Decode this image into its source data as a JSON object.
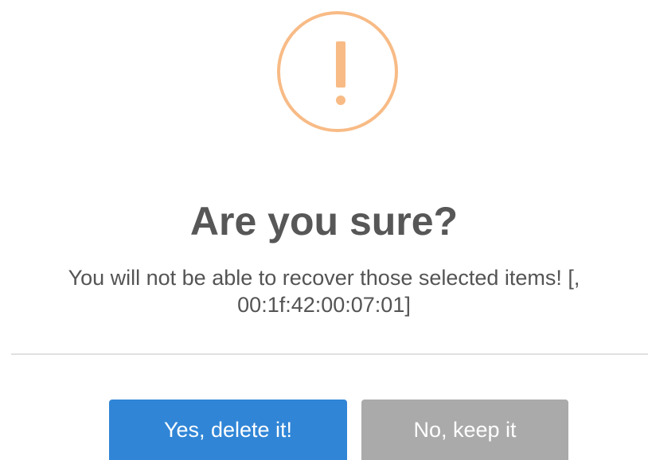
{
  "dialog": {
    "title": "Are you sure?",
    "message_line_1": "You will not be able to recover those selected items! [,",
    "message_line_2": "00:1f:42:00:07:01]",
    "icon": "warning-exclamation-icon",
    "confirm_label": "Yes, delete it!",
    "cancel_label": "No, keep it"
  },
  "colors": {
    "icon": "#f8bb86",
    "title": "#575757",
    "text": "#545454",
    "confirm": "#3085d6",
    "cancel": "#aaaaaa"
  }
}
